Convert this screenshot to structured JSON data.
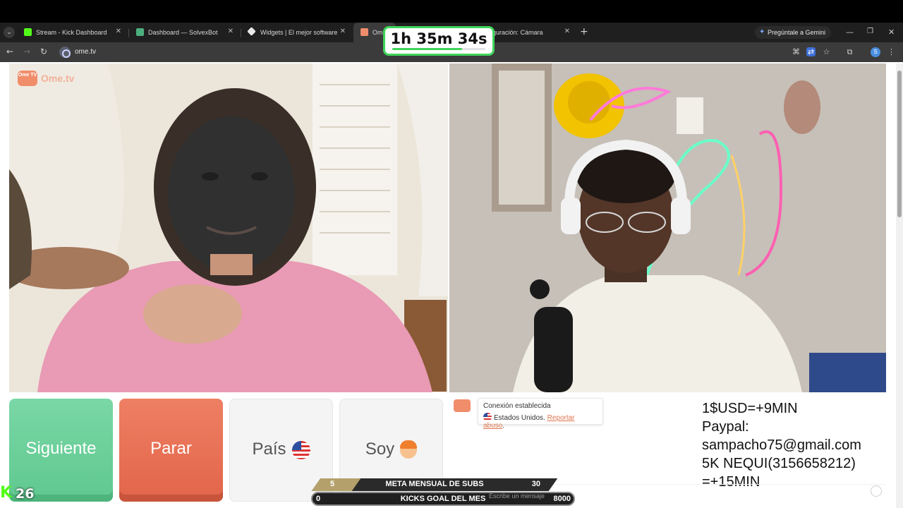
{
  "browser": {
    "tabs": [
      {
        "label": "Stream - Kick Dashboard",
        "favicon_color": "#53fc18"
      },
      {
        "label": "Dashboard — SolvexBot",
        "favicon_color": "#4caf7d"
      },
      {
        "label": "Widgets | El mejor software para",
        "favicon_color": "#e8e8e8"
      },
      {
        "label": "Ome",
        "favicon_color": "#f08d6b"
      },
      {
        "label": "guración: Cámara",
        "favicon_color": "#9aa0a6"
      }
    ],
    "new_tab_icon": "+",
    "gemini_label": "Pregúntale a Gemini",
    "url": "ome.tv",
    "profile_initial": "S"
  },
  "timer": {
    "text": "1h 35m 34s",
    "progress": 0.75,
    "border_color": "#3fd55a"
  },
  "omegle": {
    "logo_badge": "Ome TV",
    "logo_word": "Ome.tv",
    "buttons": {
      "next": "Siguiente",
      "stop": "Parar",
      "country": "País",
      "gender": "Soy"
    },
    "status": {
      "title": "Conexión establecida",
      "country": "Estados Unidos.",
      "report": "Reportar abuso",
      "report_suffix": "."
    },
    "chat_placeholder": "Escribe un mensaje",
    "donation_lines": [
      "1$USD=+9MIN",
      "Paypal:",
      "sampacho75@gmail.com",
      "5K NEQUI(3156658212)",
      "=+15MIN"
    ]
  },
  "overlay": {
    "kick_count": "26",
    "subs_goal": {
      "title": "META MENSUAL DE SUBS",
      "current": "5",
      "target": "30",
      "progress": 0.17
    },
    "kicks_goal": {
      "title": "KICKS GOAL DEL MES",
      "current": "0",
      "target": "8000",
      "progress": 0.0
    }
  },
  "colors": {
    "next_button": "#6fd39d",
    "stop_button": "#e8705a",
    "kick_green": "#53fc18"
  }
}
